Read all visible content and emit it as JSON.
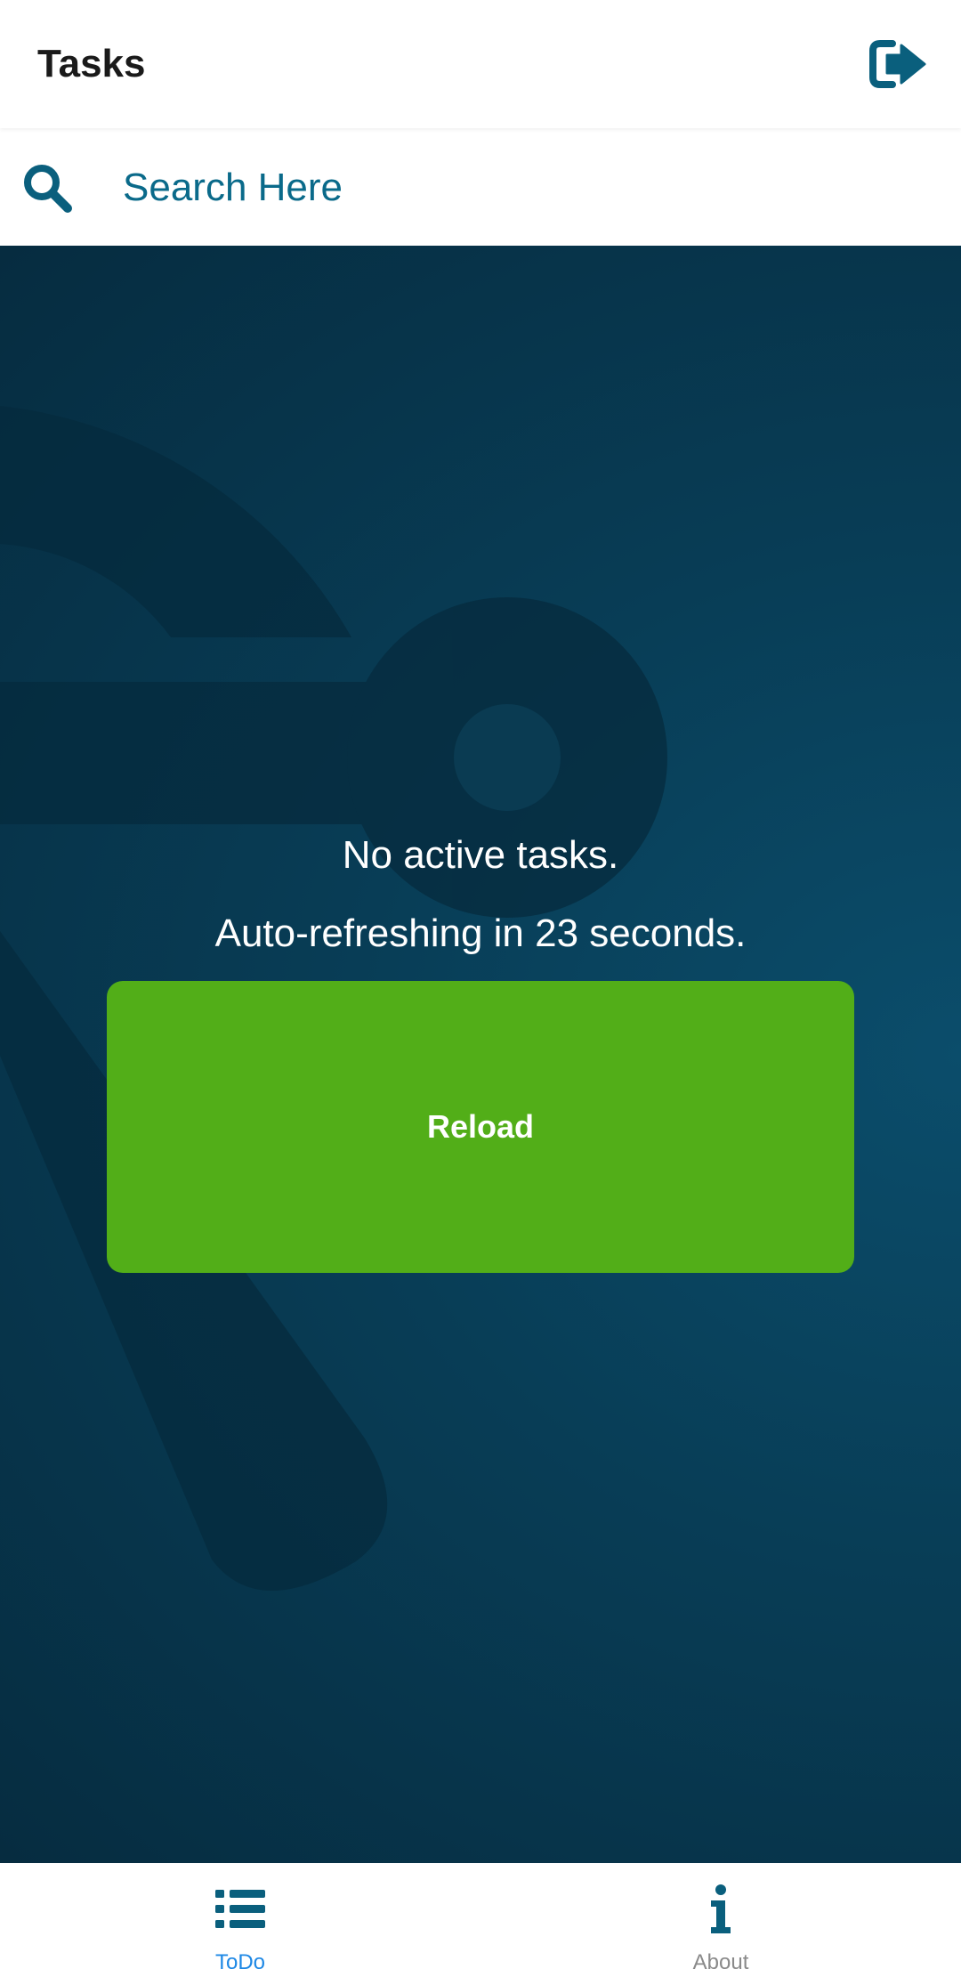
{
  "header": {
    "title": "Tasks",
    "logout_icon": "sign-out-icon"
  },
  "search": {
    "placeholder": "Search Here",
    "value": "",
    "icon": "search-icon"
  },
  "main": {
    "empty_message": "No active tasks.",
    "refresh_message": "Auto-refreshing in 23 seconds.",
    "reload_label": "Reload"
  },
  "nav": {
    "items": [
      {
        "label": "ToDo",
        "icon": "list-icon",
        "active": true
      },
      {
        "label": "About",
        "icon": "info-icon",
        "active": false
      }
    ]
  },
  "colors": {
    "accent": "#0a5f7d",
    "reload_button": "#52ae18",
    "active_tab": "#1e88e5",
    "inactive_tab": "#8a8a8a",
    "background_dark": "#083d56"
  }
}
